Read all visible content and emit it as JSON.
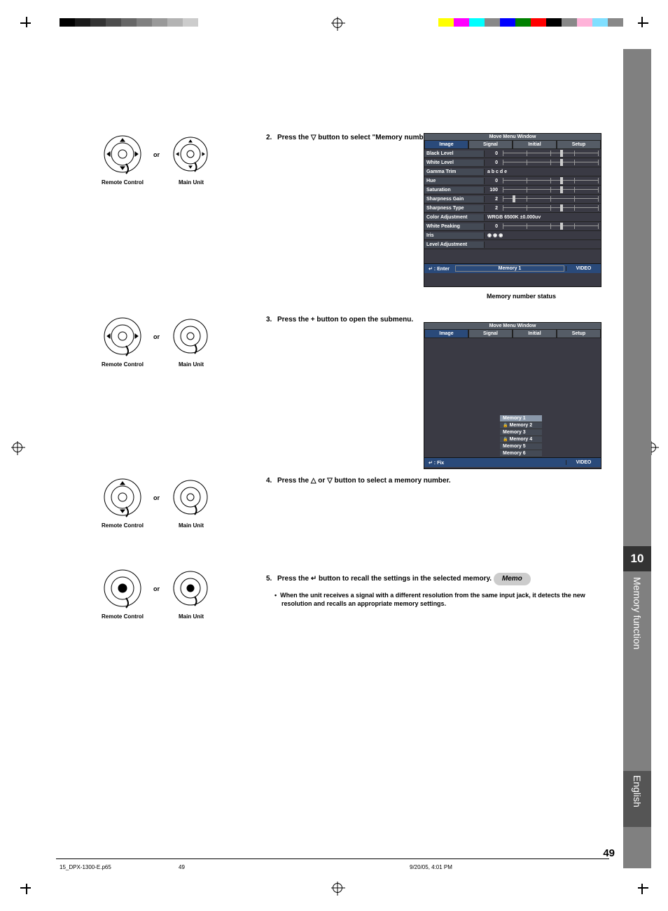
{
  "page_number": "49",
  "footer": {
    "file": "15_DPX-1300-E.p65",
    "sheet": "49",
    "datetime": "9/20/05, 4:01 PM"
  },
  "side": {
    "chapter_num": "10",
    "chapter_name": "Memory function",
    "language": "English"
  },
  "controls": {
    "remote": "Remote Control",
    "main": "Main Unit",
    "or": "or"
  },
  "steps": {
    "s2": {
      "n": "2.",
      "text_a": "Press the ",
      "text_b": " button to select \"Memory number status\" from the bottom of the screen."
    },
    "s3": {
      "n": "3.",
      "text": "Press the + button to open the submenu."
    },
    "s4": {
      "n": "4.",
      "text_a": "Press the ",
      "text_b": " or ",
      "text_c": " button to select a memory number."
    },
    "s5": {
      "n": "5.",
      "text_a": "Press the ",
      "text_b": " button to recall the settings in the selected memory."
    }
  },
  "memo": {
    "label": "Memo",
    "bullet": "When the unit receives a signal with a different resolution from the same input jack, it detects the new resolution and recalls an appropriate memory settings."
  },
  "osd": {
    "title": "Move Menu Window",
    "tabs": [
      "Image",
      "Signal",
      "Initial",
      "Setup"
    ],
    "rows": [
      {
        "label": "Black Level",
        "val": "0",
        "knob": 60
      },
      {
        "label": "White Level",
        "val": "0",
        "knob": 60
      },
      {
        "label": "Gamma Trim",
        "val": "",
        "extra": "a   b   c   d   e"
      },
      {
        "label": "Hue",
        "val": "0",
        "knob": 60
      },
      {
        "label": "Saturation",
        "val": "100",
        "knob": 60
      },
      {
        "label": "Sharpness Gain",
        "val": "2",
        "knob": 10
      },
      {
        "label": "Sharpness Type",
        "val": "2",
        "knob": 60
      },
      {
        "label": "Color Adjustment",
        "val": "",
        "extra": "WRGB          6500K ±0.000uv"
      },
      {
        "label": "White Peaking",
        "val": "0",
        "knob": 60
      },
      {
        "label": "Iris",
        "val": "",
        "extra": "◉        ◉        ◉"
      },
      {
        "label": "Level Adjustment",
        "val": "",
        "extra": ""
      }
    ],
    "foot_enter": "↵ : Enter",
    "foot_fix": "↵ : Fix",
    "foot_mem": "Memory 1",
    "foot_video": "VIDEO",
    "caption": "Memory number status",
    "mem_list": [
      "Memory 1",
      "Memory 2",
      "Memory 3",
      "Memory 4",
      "Memory 5",
      "Memory 6"
    ]
  },
  "graybar": [
    "#000",
    "#1a1a1a",
    "#333",
    "#4d4d4d",
    "#666",
    "#808080",
    "#999",
    "#b3b3b3",
    "#ccc"
  ],
  "cmykbar": [
    "#ffff00",
    "#ff00ff",
    "#00ffff",
    "#888",
    "#0000ff",
    "#008000",
    "#ff0000",
    "#000",
    "#888",
    "#ffb3d9",
    "#80dfff",
    "#888"
  ]
}
